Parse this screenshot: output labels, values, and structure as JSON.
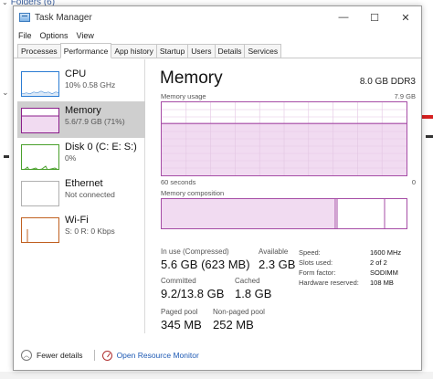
{
  "background": {
    "folders_label": "Folders (6)"
  },
  "window": {
    "title": "Task Manager",
    "controls": {
      "minimize": "—",
      "maximize": "☐",
      "close": "✕"
    }
  },
  "menu": [
    "File",
    "Options",
    "View"
  ],
  "tabs": [
    {
      "label": "Processes",
      "active": false
    },
    {
      "label": "Performance",
      "active": true
    },
    {
      "label": "App history",
      "active": false
    },
    {
      "label": "Startup",
      "active": false
    },
    {
      "label": "Users",
      "active": false
    },
    {
      "label": "Details",
      "active": false
    },
    {
      "label": "Services",
      "active": false
    }
  ],
  "resources": [
    {
      "name": "CPU",
      "detail": "10%  0.58 GHz",
      "color": "#2b7cd3"
    },
    {
      "name": "Memory",
      "detail": "5.6/7.9 GB (71%)",
      "color": "#8b1e8b"
    },
    {
      "name": "Disk 0 (C: E: S:)",
      "detail": "0%",
      "color": "#4aa02c"
    },
    {
      "name": "Ethernet",
      "detail": "Not connected",
      "color": "#b0b0b0"
    },
    {
      "name": "Wi-Fi",
      "detail": "S: 0 R: 0 Kbps",
      "color": "#c06020"
    }
  ],
  "detail": {
    "title": "Memory",
    "spec": "8.0 GB DDR3",
    "usage_label": "Memory usage",
    "usage_max": "7.9 GB",
    "time_label": "60 seconds",
    "time_end": "0",
    "composition_label": "Memory composition",
    "usage_fill_fraction": 0.71,
    "accent_color": "#a64ca6",
    "stats": {
      "in_use_label": "In use (Compressed)",
      "in_use_value": "5.6 GB (623 MB)",
      "available_label": "Available",
      "available_value": "2.3 GB",
      "committed_label": "Committed",
      "committed_value": "9.2/13.8 GB",
      "cached_label": "Cached",
      "cached_value": "1.8 GB",
      "paged_label": "Paged pool",
      "paged_value": "345 MB",
      "nonpaged_label": "Non-paged pool",
      "nonpaged_value": "252 MB"
    },
    "kv": [
      {
        "label": "Speed:",
        "value": "1600 MHz"
      },
      {
        "label": "Slots used:",
        "value": "2 of 2"
      },
      {
        "label": "Form factor:",
        "value": "SODIMM"
      },
      {
        "label": "Hardware reserved:",
        "value": "108 MB"
      }
    ]
  },
  "footer": {
    "fewer_details": "Fewer details",
    "open_resource_monitor": "Open Resource Monitor"
  }
}
